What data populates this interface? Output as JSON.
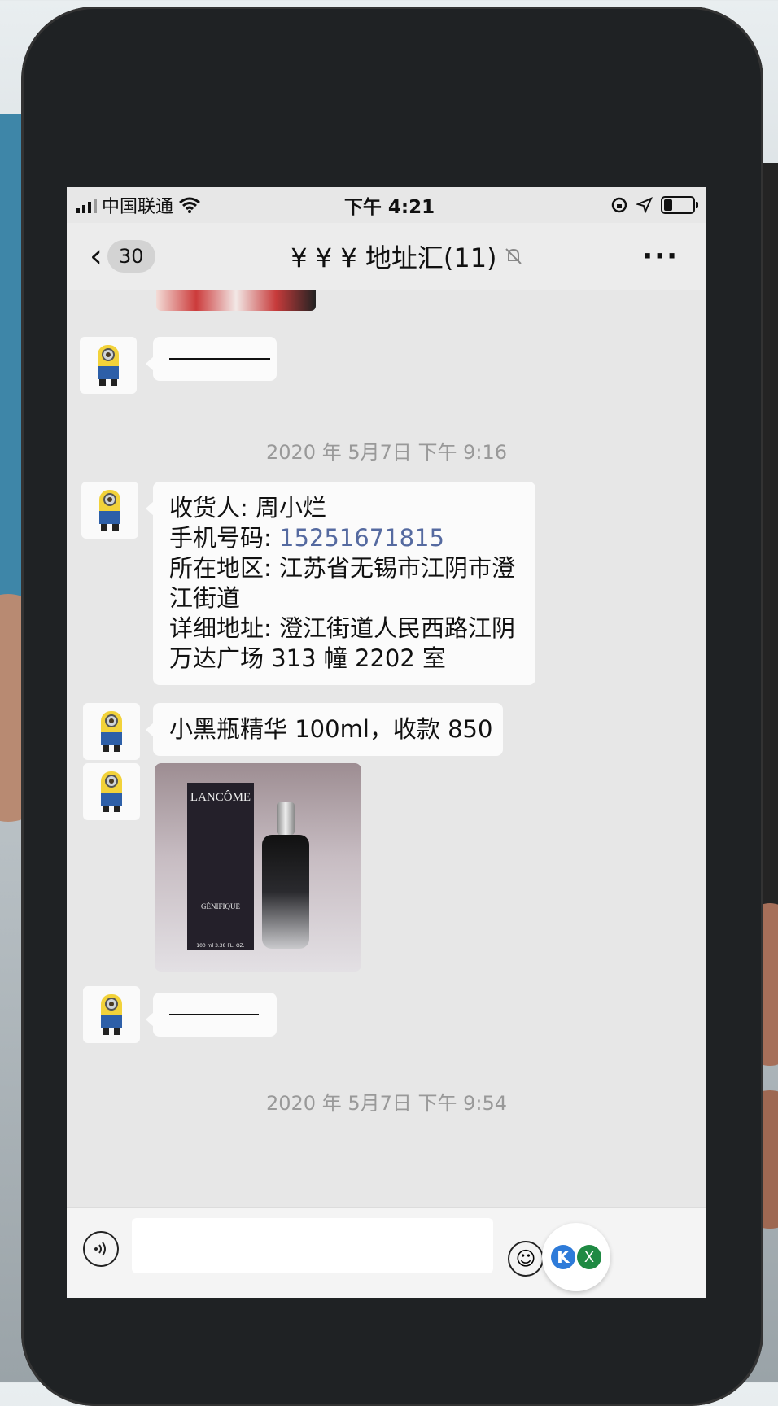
{
  "status_bar": {
    "carrier": "中国联通",
    "time": "下午 4:21"
  },
  "nav": {
    "unread_count": "30",
    "title": "¥ ¥ ¥ 地址汇(11)",
    "more": "···"
  },
  "messages": {
    "timestamp_1": "2020 年 5月7日 下午 9:16",
    "address": {
      "line1": "收货人: 周小烂",
      "line2_label": "手机号码: ",
      "line2_phone": "15251671815",
      "line3": "所在地区: 江苏省无锡市江阴市澄江街道",
      "line4": "详细地址: 澄江街道人民西路江阴万达广场 313 幢 2202 室"
    },
    "order_text": "小黑瓶精华 100ml，收款 850",
    "photo": {
      "brand": "LANCÔME",
      "product": "GÉNIFIQUE",
      "volume": "100 ml 3.38 FL. OZ."
    },
    "timestamp_2": "2020 年 5月7日 下午 9:54"
  },
  "input_bar": {
    "message_value": "",
    "widget_k": "K",
    "widget_x": "X"
  },
  "colors": {
    "screen_bg": "#e7e7e7",
    "bubble_bg": "#fbfbfb",
    "link": "#556aa0",
    "timestamp": "#999999"
  },
  "icons": [
    "signal-bars-icon",
    "wifi-icon",
    "rotation-lock-icon",
    "location-icon",
    "battery-icon",
    "chevron-left-icon",
    "mute-bell-icon",
    "more-icon",
    "voice-icon",
    "emoji-icon"
  ]
}
